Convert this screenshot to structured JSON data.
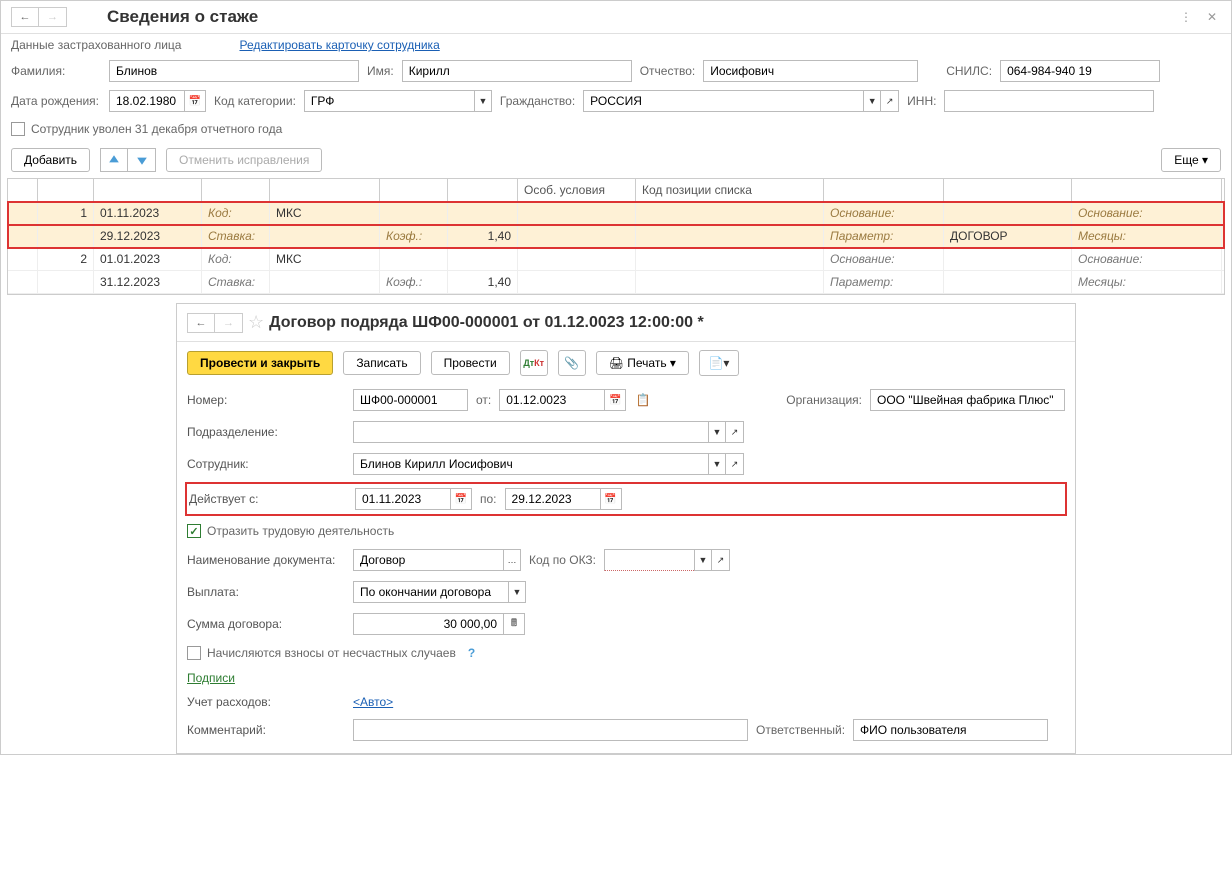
{
  "main": {
    "title": "Сведения о стаже",
    "subtitle": "Данные застрахованного лица",
    "edit_link": "Редактировать карточку сотрудника",
    "fields": {
      "surname_label": "Фамилия:",
      "surname": "Блинов",
      "name_label": "Имя:",
      "name": "Кирилл",
      "patronymic_label": "Отчество:",
      "patronymic": "Иосифович",
      "snils_label": "СНИЛС:",
      "snils": "064-984-940 19",
      "birthdate_label": "Дата рождения:",
      "birthdate": "18.02.1980",
      "category_label": "Код категории:",
      "category": "ГРФ",
      "citizenship_label": "Гражданство:",
      "citizenship": "РОССИЯ",
      "inn_label": "ИНН:",
      "inn": ""
    },
    "dismissed_label": "Сотрудник уволен 31 декабря отчетного года",
    "toolbar": {
      "add": "Добавить",
      "cancel": "Отменить исправления",
      "more": "Еще"
    },
    "table": {
      "headers": {
        "special": "Особ. условия",
        "position": "Код позиции списка"
      },
      "labels": {
        "code": "Код:",
        "rate": "Ставка:",
        "coef": "Коэф.:",
        "basis": "Основание:",
        "param": "Параметр:",
        "months": "Месяцы:"
      },
      "rows": [
        {
          "n": "1",
          "date1": "01.11.2023",
          "date2": "29.12.2023",
          "code": "МКС",
          "coef": "1,40",
          "param": "ДОГОВОР",
          "highlight": true
        },
        {
          "n": "2",
          "date1": "01.01.2023",
          "date2": "31.12.2023",
          "code": "МКС",
          "coef": "1,40",
          "param": "",
          "highlight": false
        }
      ]
    }
  },
  "sub": {
    "title": "Договор подряда ШФ00-000001 от 01.12.0023 12:00:00 *",
    "toolbar": {
      "post_close": "Провести и закрыть",
      "save": "Записать",
      "post": "Провести",
      "print": "Печать"
    },
    "fields": {
      "number_label": "Номер:",
      "number": "ШФ00-000001",
      "from_label": "от:",
      "from_date": "01.12.0023",
      "org_label": "Организация:",
      "org": "ООО \"Швейная фабрика Плюс\"",
      "dept_label": "Подразделение:",
      "dept": "",
      "employee_label": "Сотрудник:",
      "employee": "Блинов Кирилл Иосифович",
      "valid_from_label": "Действует с:",
      "valid_from": "01.11.2023",
      "valid_to_label": "по:",
      "valid_to": "29.12.2023",
      "reflect_label": "Отразить трудовую деятельность",
      "docname_label": "Наименование документа:",
      "docname": "Договор",
      "okz_label": "Код по ОКЗ:",
      "okz": "",
      "payment_label": "Выплата:",
      "payment": "По окончании договора",
      "sum_label": "Сумма договора:",
      "sum": "30 000,00",
      "accident_label": "Начисляются взносы от несчастных случаев",
      "signatures": "Подписи",
      "expense_label": "Учет расходов:",
      "expense_link": "<Авто>",
      "comment_label": "Комментарий:",
      "comment": "",
      "responsible_label": "Ответственный:",
      "responsible": "ФИО пользователя"
    }
  }
}
